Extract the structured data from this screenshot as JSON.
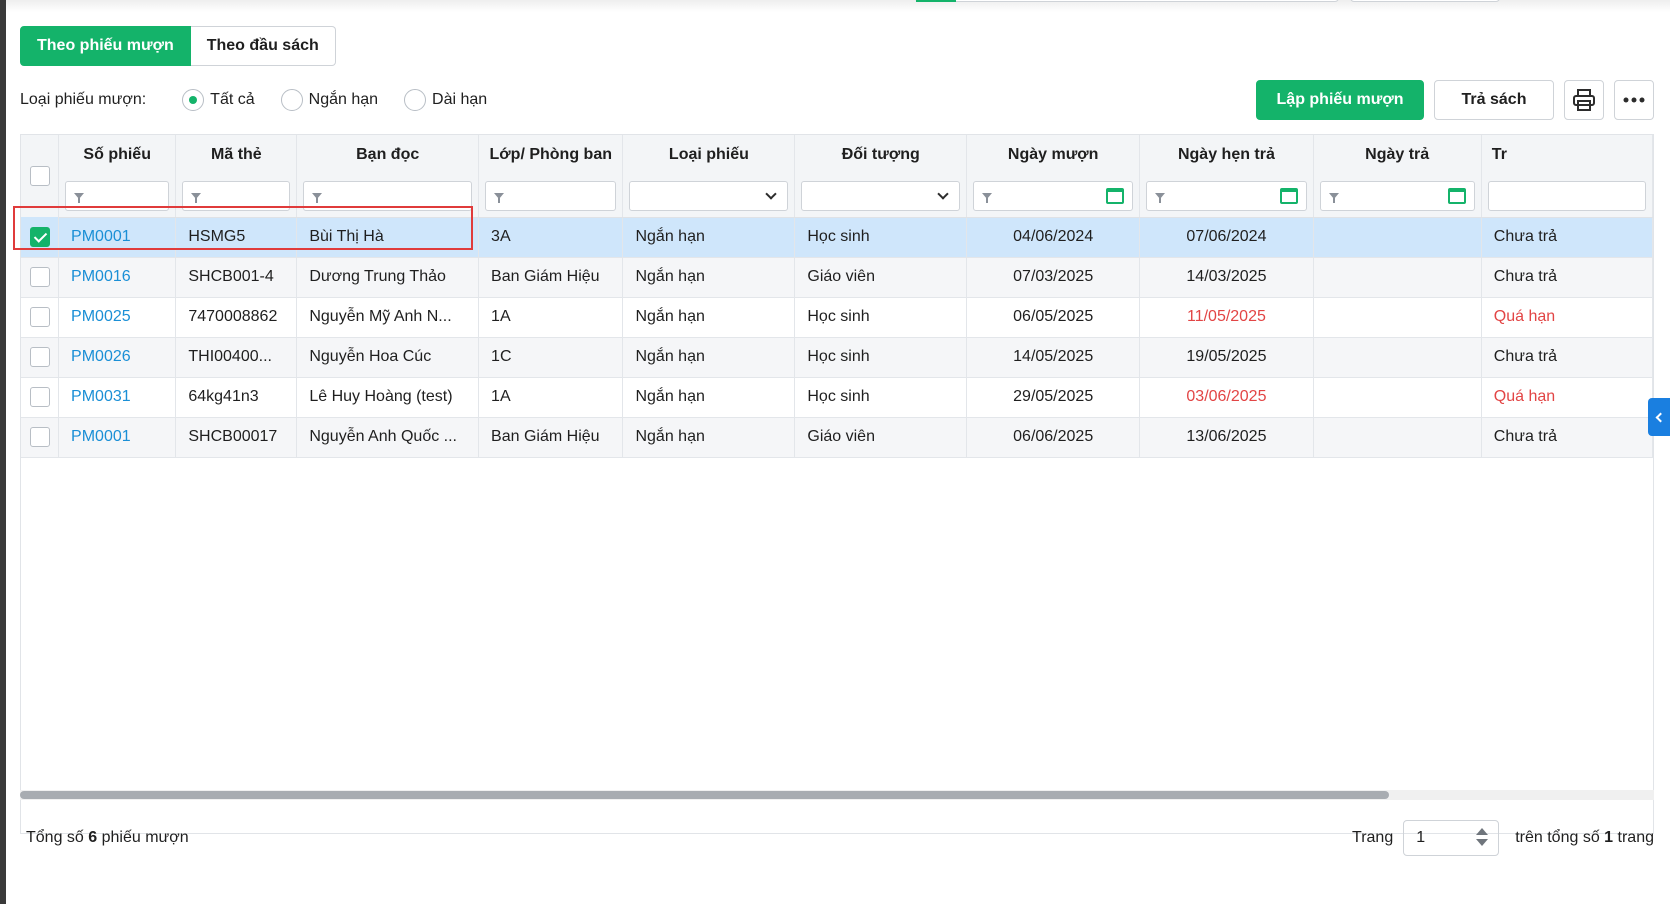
{
  "tabs": [
    {
      "label": "Theo phiếu mượn",
      "active": true
    },
    {
      "label": "Theo đầu sách",
      "active": false
    }
  ],
  "filter": {
    "label": "Loại phiếu mượn:",
    "options": [
      {
        "label": "Tất cả",
        "checked": true
      },
      {
        "label": "Ngắn hạn",
        "checked": false
      },
      {
        "label": "Dài hạn",
        "checked": false
      }
    ]
  },
  "actions": {
    "create_label": "Lập phiếu mượn",
    "return_label": "Trả sách",
    "print_icon": "printer-icon",
    "more_icon": "more-dots-icon"
  },
  "columns": [
    "Số phiếu",
    "Mã thẻ",
    "Bạn đọc",
    "Lớp/ Phòng ban",
    "Loại phiếu",
    "Đối tượng",
    "Ngày mượn",
    "Ngày hẹn trả",
    "Ngày trả",
    "Tr"
  ],
  "rows": [
    {
      "so_phieu": "PM0001",
      "ma_the": "HSMG5",
      "ban_doc": "Bùi Thị Hà",
      "lop": "3A",
      "loai": "Ngắn hạn",
      "doi_tuong": "Học sinh",
      "ngay_muon": "04/06/2024",
      "ngay_hen_tra": "07/06/2024",
      "ngay_tra": "",
      "trang_thai": "Chưa trả",
      "checked": true,
      "overdue": false
    },
    {
      "so_phieu": "PM0016",
      "ma_the": "SHCB001-4",
      "ban_doc": "Dương Trung Thảo",
      "lop": "Ban Giám Hiệu",
      "loai": "Ngắn hạn",
      "doi_tuong": "Giáo viên",
      "ngay_muon": "07/03/2025",
      "ngay_hen_tra": "14/03/2025",
      "ngay_tra": "",
      "trang_thai": "Chưa trả",
      "checked": false,
      "overdue": false
    },
    {
      "so_phieu": "PM0025",
      "ma_the": "7470008862",
      "ban_doc": "Nguyễn Mỹ Anh N...",
      "lop": "1A",
      "loai": "Ngắn hạn",
      "doi_tuong": "Học sinh",
      "ngay_muon": "06/05/2025",
      "ngay_hen_tra": "11/05/2025",
      "ngay_tra": "",
      "trang_thai": "Quá hạn",
      "checked": false,
      "overdue": true
    },
    {
      "so_phieu": "PM0026",
      "ma_the": "THI00400...",
      "ban_doc": "Nguyễn Hoa Cúc",
      "lop": "1C",
      "loai": "Ngắn hạn",
      "doi_tuong": "Học sinh",
      "ngay_muon": "14/05/2025",
      "ngay_hen_tra": "19/05/2025",
      "ngay_tra": "",
      "trang_thai": "Chưa trả",
      "checked": false,
      "overdue": false
    },
    {
      "so_phieu": "PM0031",
      "ma_the": "64kg41n3",
      "ban_doc": "Lê Huy Hoàng (test)",
      "lop": "1A",
      "loai": "Ngắn hạn",
      "doi_tuong": "Học sinh",
      "ngay_muon": "29/05/2025",
      "ngay_hen_tra": "03/06/2025",
      "ngay_tra": "",
      "trang_thai": "Quá hạn",
      "checked": false,
      "overdue": true
    },
    {
      "so_phieu": "PM0001",
      "ma_the": "SHCB00017",
      "ban_doc": "Nguyễn Anh Quốc ...",
      "lop": "Ban Giám Hiệu",
      "loai": "Ngắn hạn",
      "doi_tuong": "Giáo viên",
      "ngay_muon": "06/06/2025",
      "ngay_hen_tra": "13/06/2025",
      "ngay_tra": "",
      "trang_thai": "Chưa trả",
      "checked": false,
      "overdue": false
    }
  ],
  "footer": {
    "total_prefix": "Tổng số",
    "total_count": "6",
    "total_suffix": "phiếu mượn",
    "page_label": "Trang",
    "page_value": "1",
    "of_prefix": "trên tổng số",
    "of_count": "1",
    "of_suffix": "trang"
  },
  "colors": {
    "primary": "#14b36a",
    "link": "#1a8fd6",
    "overdue": "#e24545",
    "selected_row": "#cfe6fb"
  }
}
